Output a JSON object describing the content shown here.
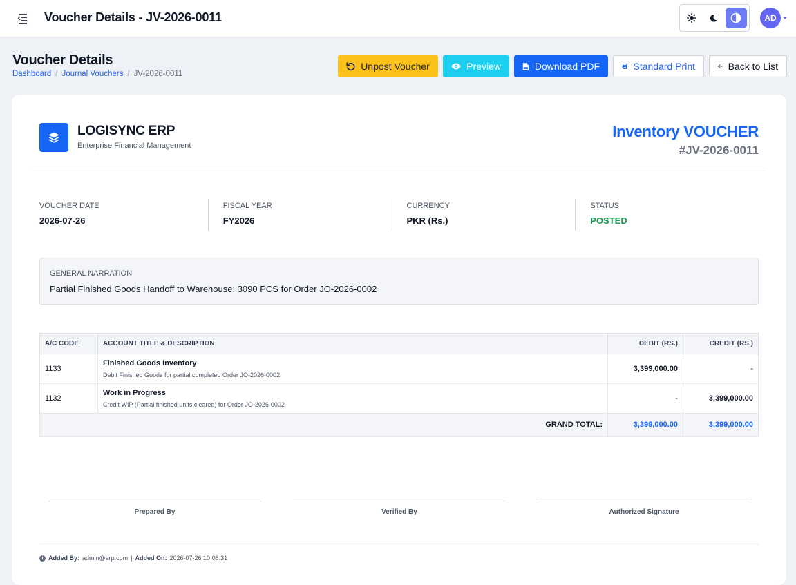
{
  "header": {
    "title": "Voucher Details - JV-2026-0011",
    "avatar_initials": "AD"
  },
  "page": {
    "title": "Voucher Details",
    "breadcrumb": [
      "Dashboard",
      "Journal Vouchers",
      "JV-2026-0011"
    ]
  },
  "actions": {
    "unpost": "Unpost Voucher",
    "preview": "Preview",
    "download": "Download PDF",
    "print": "Standard Print",
    "back": "Back to List"
  },
  "company": {
    "name": "LOGISYNC ERP",
    "tagline": "Enterprise Financial Management"
  },
  "voucher": {
    "type_title": "Inventory VOUCHER",
    "number": "#JV-2026-0011"
  },
  "info": [
    {
      "label": "VOUCHER DATE",
      "value": "2026-07-26"
    },
    {
      "label": "FISCAL YEAR",
      "value": "FY2026"
    },
    {
      "label": "CURRENCY",
      "value": "PKR (Rs.)"
    },
    {
      "label": "STATUS",
      "value": "POSTED"
    }
  ],
  "narration": {
    "label": "GENERAL NARRATION",
    "text": "Partial Finished Goods Handoff to Warehouse: 3090 PCS for Order JO-2026-0002"
  },
  "table": {
    "headers": [
      "A/C CODE",
      "ACCOUNT TITLE & DESCRIPTION",
      "DEBIT (RS.)",
      "CREDIT (RS.)"
    ],
    "rows": [
      {
        "code": "1133",
        "title": "Finished Goods Inventory",
        "description": "Debit Finished Goods for partial completed Order JO-2026-0002",
        "debit": "3,399,000.00",
        "credit": "-"
      },
      {
        "code": "1132",
        "title": "Work in Progress",
        "description": "Credit WIP (Partial finished units cleared) for Order JO-2026-0002",
        "debit": "-",
        "credit": "3,399,000.00"
      }
    ],
    "total_label": "GRAND TOTAL:",
    "total_debit": "3,399,000.00",
    "total_credit": "3,399,000.00"
  },
  "signatures": [
    "Prepared By",
    "Verified By",
    "Authorized Signature"
  ],
  "footer": {
    "added_by_label": "Added By:",
    "added_by": "admin@erp.com",
    "separator": "|",
    "added_on_label": "Added On:",
    "added_on": "2026-07-26 10:06:31"
  },
  "colors": {
    "primary": "#1565f7",
    "warning": "#fcc11b",
    "info": "#1ccfee",
    "success": "#1a9a50",
    "avatar": "#6366f1"
  },
  "icons": {
    "menu": "menu-collapse-icon",
    "theme_light": "sun-icon",
    "theme_dark": "moon-icon",
    "theme_auto": "contrast-icon",
    "unpost": "undo-icon",
    "preview": "eye-icon",
    "download": "pdf-file-icon",
    "print": "printer-icon",
    "back": "arrow-left-icon",
    "logo": "layers-icon"
  }
}
